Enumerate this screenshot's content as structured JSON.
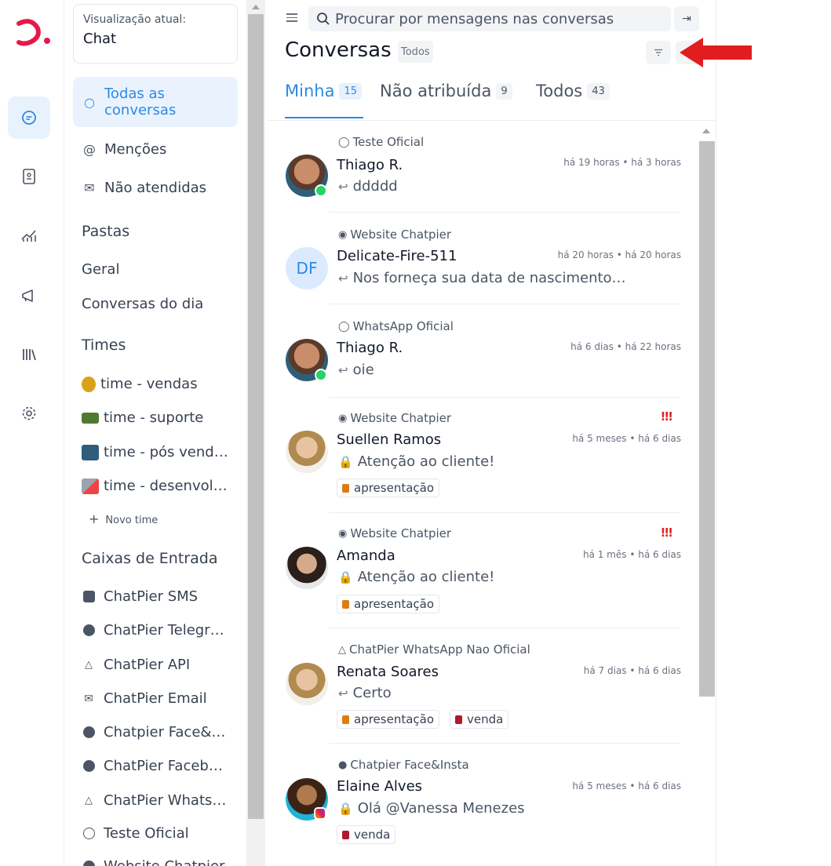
{
  "sidebar": {
    "current_view_label": "Visualização atual:",
    "current_view_value": "Chat",
    "all_conversations": "Todas as conversas",
    "mentions": "Menções",
    "unattended": "Não atendidas",
    "folders_title": "Pastas",
    "folders": [
      "Geral",
      "Conversas do dia"
    ],
    "teams_title": "Times",
    "teams": [
      "time - vendas",
      "time - suporte",
      "time - pós vend…",
      "time - desenvol…"
    ],
    "new_team": "Novo time",
    "inboxes_title": "Caixas de Entrada",
    "inboxes": [
      "ChatPier SMS",
      "ChatPier Telegr…",
      "ChatPier API",
      "ChatPier Email",
      "Chatpier Face&…",
      "ChatPier Faceb…",
      "ChatPier Whats…",
      "Teste Oficial",
      "Website Chatpier"
    ]
  },
  "header": {
    "search_placeholder": "Procurar por mensagens nas conversas",
    "title": "Conversas",
    "title_badge": "Todos"
  },
  "tabs": [
    {
      "label": "Minha",
      "count": "15"
    },
    {
      "label": "Não atribuída",
      "count": "9"
    },
    {
      "label": "Todos",
      "count": "43"
    }
  ],
  "conversations": [
    {
      "inbox": "Teste Oficial",
      "name": "Thiago R.",
      "time": "há 19 horas • há 3 horas",
      "message": "ddddd"
    },
    {
      "inbox": "Website Chatpier",
      "name": "Delicate-Fire-511",
      "initials": "DF",
      "time": "há 20 horas • há 20 horas",
      "message": "Nos forneça sua data de nascimento…"
    },
    {
      "inbox": "WhatsApp Oficial",
      "name": "Thiago R.",
      "time": "há 6 dias • há 22 horas",
      "message": "oie"
    },
    {
      "inbox": "Website Chatpier",
      "name": "Suellen Ramos",
      "time": "há 5 meses • há 6 dias",
      "message": "Atenção ao cliente!",
      "labels": [
        "apresentação"
      ],
      "priority": "!!!"
    },
    {
      "inbox": "Website Chatpier",
      "name": "Amanda",
      "time": "há 1 mês • há 6 dias",
      "message": "Atenção ao cliente!",
      "labels": [
        "apresentação"
      ],
      "priority": "!!!"
    },
    {
      "inbox": "ChatPier WhatsApp Nao Oficial",
      "name": "Renata Soares",
      "time": "há 7 dias • há 6 dias",
      "message": "Certo",
      "labels": [
        "apresentação",
        "venda"
      ]
    },
    {
      "inbox": "Chatpier Face&Insta",
      "name": "Elaine Alves",
      "time": "há 5 meses • há 6 dias",
      "message": "Olá @Vanessa Menezes",
      "labels": [
        "venda"
      ]
    }
  ],
  "colors": {
    "accent": "#2b8ae4",
    "brand": "#e8174a",
    "label_orange": "#e07b12",
    "label_red": "#b4172b",
    "priority": "#dc2626"
  }
}
